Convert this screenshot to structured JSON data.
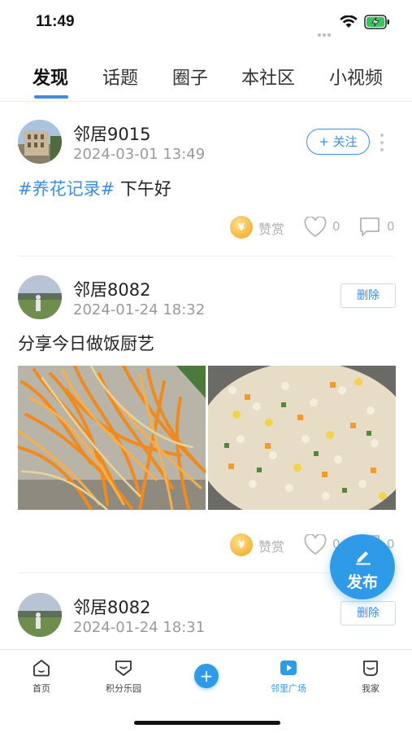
{
  "status_bar": {
    "time": "11:49"
  },
  "tabs": [
    {
      "label": "发现",
      "active": true
    },
    {
      "label": "话题",
      "active": false
    },
    {
      "label": "圈子",
      "active": false
    },
    {
      "label": "本社区",
      "active": false
    },
    {
      "label": "小视频",
      "active": false
    }
  ],
  "posts": [
    {
      "username": "邻居9015",
      "timestamp": "2024-03-01 13:49",
      "action_label": "+ 关注",
      "hashtag": "#养花记录#",
      "text": " 下午好",
      "reward_label": "赞赏",
      "like_count": "0",
      "comment_count": "0"
    },
    {
      "username": "邻居8082",
      "timestamp": "2024-01-24 18:32",
      "action_label": "删除",
      "text": "分享今日做饭厨艺",
      "reward_label": "赞赏",
      "like_count": "0",
      "comment_count": "0"
    },
    {
      "username": "邻居8082",
      "timestamp": "2024-01-24 18:31",
      "action_label": "删除"
    }
  ],
  "publish_button": {
    "label": "发布"
  },
  "bottom_nav": [
    {
      "label": "首页",
      "icon": "home-icon",
      "active": false
    },
    {
      "label": "积分乐园",
      "icon": "points-icon",
      "active": false
    },
    {
      "label": "",
      "icon": "plus-icon",
      "active": false
    },
    {
      "label": "邻里广场",
      "icon": "square-icon",
      "active": true
    },
    {
      "label": "我家",
      "icon": "my-home-icon",
      "active": false
    }
  ],
  "colors": {
    "accent": "#3a8ee6",
    "fab": "#2f9be8",
    "muted": "#9a9a9a",
    "coin": "#f4b63c"
  }
}
